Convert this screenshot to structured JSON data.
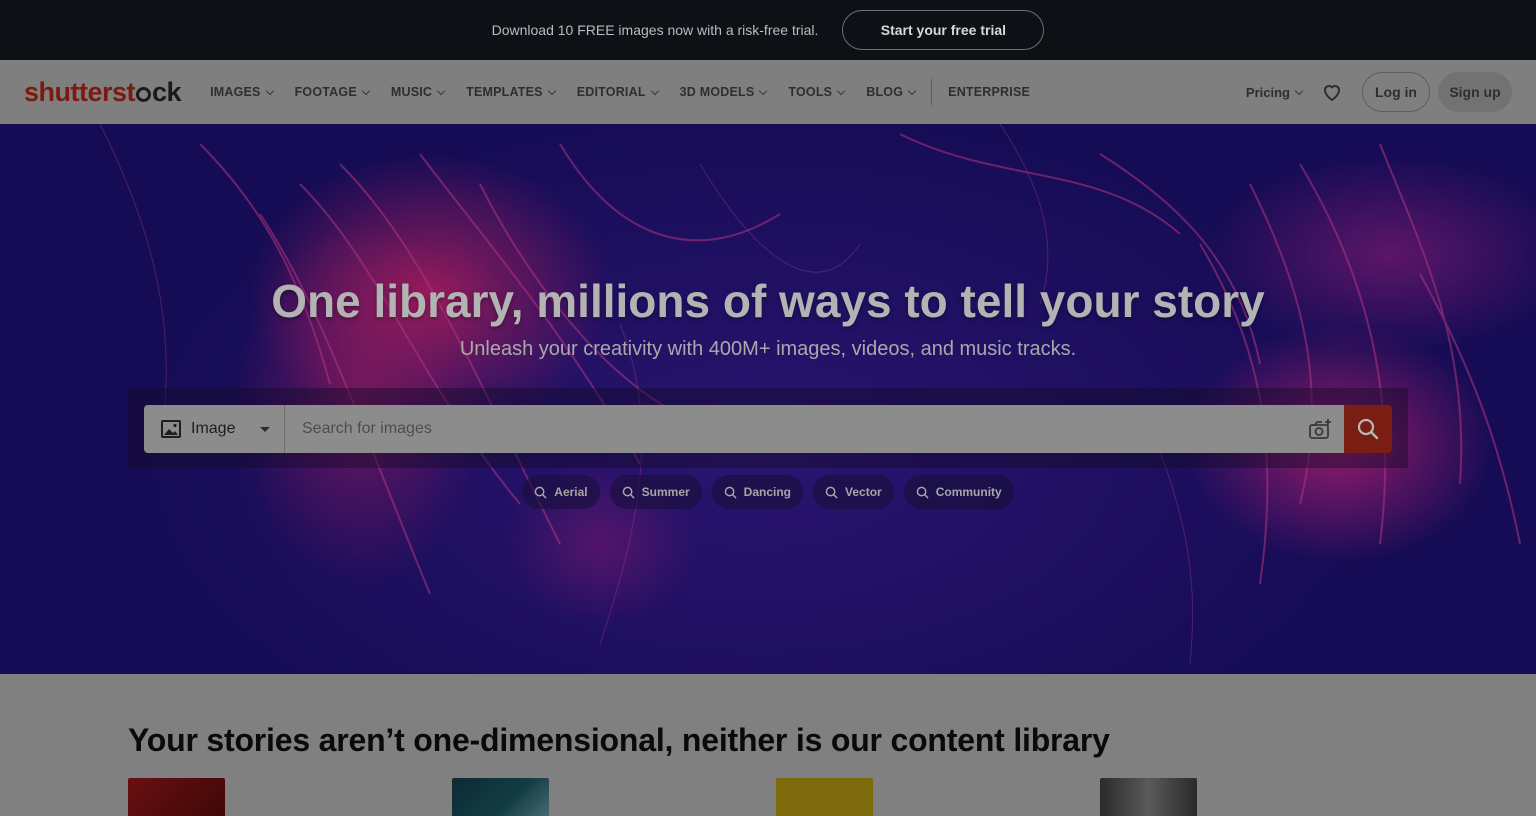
{
  "promo": {
    "text": "Download 10 FREE images now with a risk-free trial.",
    "cta": "Start your free trial"
  },
  "nav": {
    "logo": {
      "part1": "shutterst",
      "part2": "ck"
    },
    "menu": [
      {
        "label": "IMAGES"
      },
      {
        "label": "FOOTAGE"
      },
      {
        "label": "MUSIC"
      },
      {
        "label": "TEMPLATES"
      },
      {
        "label": "EDITORIAL"
      },
      {
        "label": "3D MODELS"
      },
      {
        "label": "TOOLS"
      },
      {
        "label": "BLOG"
      }
    ],
    "enterprise": "ENTERPRISE",
    "pricing": "Pricing",
    "login": "Log in",
    "signup": "Sign up"
  },
  "hero": {
    "title": "One library, millions of ways to tell your story",
    "subtitle": "Unleash your creativity with 400M+ images, videos, and music tracks.",
    "search": {
      "type_label": "Image",
      "placeholder": "Search for images"
    },
    "chips": [
      {
        "label": "Aerial"
      },
      {
        "label": "Summer"
      },
      {
        "label": "Dancing"
      },
      {
        "label": "Vector"
      },
      {
        "label": "Community"
      }
    ]
  },
  "section": {
    "title": "Your stories aren’t one-dimensional, neither is our content library"
  },
  "colors": {
    "brand_red": "#e8341c",
    "overlay": "rgba(0,0,0,0.5)"
  }
}
